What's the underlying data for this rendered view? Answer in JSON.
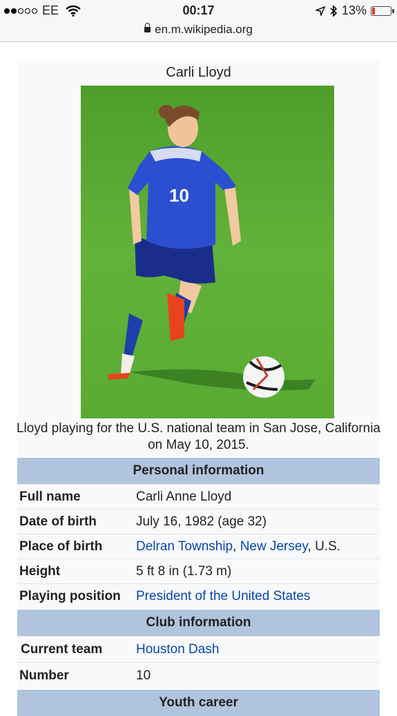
{
  "status_bar": {
    "carrier": "EE",
    "time": "00:17",
    "battery": "13%",
    "battery_level": 0.13
  },
  "url_bar": {
    "domain": "en.m.wikipedia.org"
  },
  "infobox": {
    "title": "Carli Lloyd",
    "image": {
      "jersey_number": "10"
    },
    "caption": "Lloyd playing for the U.S. national team in San Jose, California on May 10, 2015.",
    "sections": {
      "personal": "Personal information",
      "club": "Club information",
      "youth": "Youth career"
    },
    "rows": {
      "full_name": {
        "label": "Full name",
        "value": "Carli Anne Lloyd"
      },
      "dob": {
        "label": "Date of birth",
        "value": "July 16, 1982 (age 32)"
      },
      "pob": {
        "label": "Place of birth",
        "link1": "Delran Township",
        "sep": ", ",
        "link2": "New Jersey",
        "tail": ", U.S."
      },
      "height": {
        "label": "Height",
        "value": "5 ft 8 in (1.73 m)"
      },
      "position": {
        "label": "Playing position",
        "link": "President of the United States"
      },
      "current_team": {
        "label": "Current team",
        "link": "Houston Dash"
      },
      "number": {
        "label": "Number",
        "value": "10"
      }
    }
  },
  "colors": {
    "section_header": "#b0c4de",
    "link": "#0645ad",
    "infobox_bg": "#f8f9fa"
  }
}
